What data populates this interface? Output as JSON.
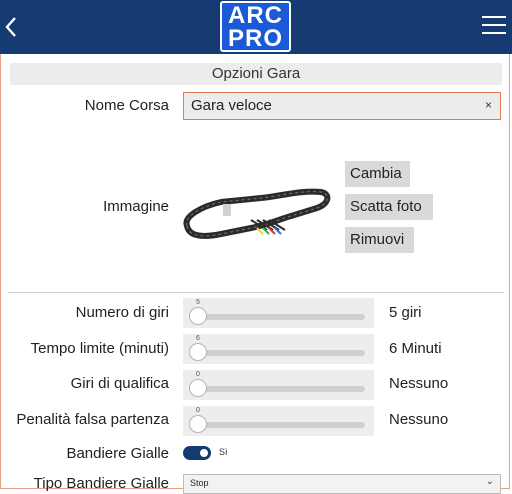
{
  "header": {
    "logo_line1": "ARC",
    "logo_line2": "PRO",
    "brand_color": "#163a72",
    "icons": {
      "back": "chevron-left-icon",
      "menu": "hamburger-menu-icon"
    }
  },
  "section": {
    "title": "Opzioni Gara"
  },
  "race_name": {
    "label": "Nome Corsa",
    "value": "Gara veloce",
    "clear_glyph": "×"
  },
  "image": {
    "label": "Immagine",
    "buttons": {
      "change": "Cambia",
      "take_photo": "Scatta foto",
      "remove": "Rimuovi"
    }
  },
  "sliders": [
    {
      "label": "Numero di giri",
      "tip": "5",
      "value_text": "5 giri",
      "level": 0.0
    },
    {
      "label": "Tempo limite (minuti)",
      "tip": "6",
      "value_text": "6 Minuti",
      "level": 0.0
    },
    {
      "label": "Giri di qualifica",
      "tip": "0",
      "value_text": "Nessuno",
      "level": 0.0
    },
    {
      "label": "Penalità falsa partenza",
      "tip": "0",
      "value_text": "Nessuno",
      "level": 0.0
    }
  ],
  "yellow_flags": {
    "label": "Bandiere Gialle",
    "state": "Sì",
    "on": true
  },
  "yellow_flag_type": {
    "label": "Tipo Bandiere Gialle",
    "selected": "Stop"
  },
  "colors": {
    "accent_border": "#e07b53",
    "logo_blue": "#1a5ad6"
  }
}
